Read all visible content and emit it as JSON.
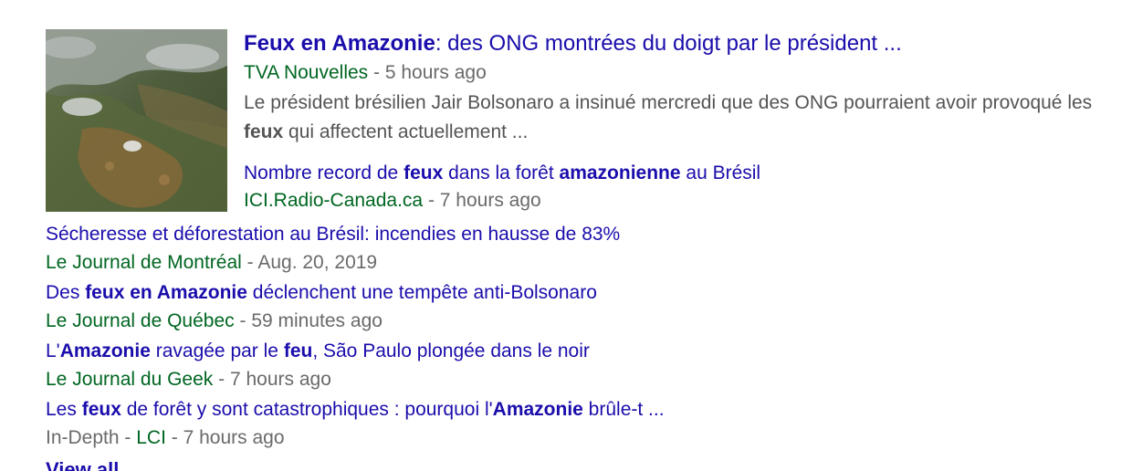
{
  "thumbnail": {
    "alt": "satellite image of Amazon fires"
  },
  "top_story": {
    "title_parts": [
      {
        "text": "Feux en Amazonie",
        "bold": true
      },
      {
        "text": ": des ONG montrées du doigt par le président ...",
        "bold": false
      }
    ],
    "source": "TVA Nouvelles",
    "sep": " - ",
    "time": "5 hours ago",
    "snippet_parts": [
      {
        "text": "Le président brésilien Jair Bolsonaro a insinué mercredi que des ONG pourraient avoir provoqué les ",
        "bold": false
      },
      {
        "text": "feux",
        "bold": true
      },
      {
        "text": " qui affectent actuellement ...",
        "bold": false
      }
    ],
    "sub_story": {
      "title_parts": [
        {
          "text": "Nombre record de ",
          "bold": false
        },
        {
          "text": "feux",
          "bold": true
        },
        {
          "text": " dans la forêt ",
          "bold": false
        },
        {
          "text": "amazonienne",
          "bold": true
        },
        {
          "text": " au Brésil",
          "bold": false
        }
      ],
      "source": "ICI.Radio-Canada.ca",
      "sep": " - ",
      "time": "7 hours ago"
    }
  },
  "stories": [
    {
      "title_parts": [
        {
          "text": "Sécheresse et déforestation au Brésil: incendies en hausse de 83%",
          "bold": false
        }
      ],
      "source": "Le Journal de Montréal",
      "time": "Aug. 20, 2019"
    },
    {
      "title_parts": [
        {
          "text": "Des ",
          "bold": false
        },
        {
          "text": "feux en Amazonie",
          "bold": true
        },
        {
          "text": " déclenchent une tempête anti-Bolsonaro",
          "bold": false
        }
      ],
      "source": "Le Journal de Québec",
      "time": "59 minutes ago"
    },
    {
      "title_parts": [
        {
          "text": "L'",
          "bold": false
        },
        {
          "text": "Amazonie",
          "bold": true
        },
        {
          "text": " ravagée par le ",
          "bold": false
        },
        {
          "text": "feu",
          "bold": true
        },
        {
          "text": ", São Paulo plongée dans le noir",
          "bold": false
        }
      ],
      "source": "Le Journal du Geek",
      "time": "7 hours ago"
    },
    {
      "title_parts": [
        {
          "text": "Les ",
          "bold": false
        },
        {
          "text": "feux",
          "bold": true
        },
        {
          "text": " de forêt y sont catastrophiques : pourquoi l'",
          "bold": false
        },
        {
          "text": "Amazonie",
          "bold": true
        },
        {
          "text": " brûle-t ...",
          "bold": false
        }
      ],
      "prefix": "In-Depth",
      "source": "LCI",
      "time": "7 hours ago"
    }
  ],
  "separator": " - ",
  "cutoff_text": "View all"
}
